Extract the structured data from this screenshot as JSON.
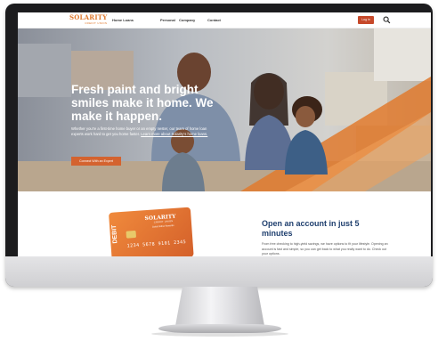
{
  "nav": {
    "logo_main": "SOLARITY",
    "logo_sub": "CREDIT UNION",
    "links": [
      "Home Loans",
      "Personal",
      "Company",
      "Contact"
    ],
    "login_label": "Log in"
  },
  "hero": {
    "title": "Fresh paint and bright smiles make it home. We make it happen.",
    "text": "Whether you're a first-time home buyer or an empty nester, our team of home loan experts work hard to get you home faster.",
    "link_text": "Learn more about Solarity's home loans.",
    "cta_label": "Connect With an Expert"
  },
  "card": {
    "logo": "SOLARITY",
    "sub": "CREDIT UNION",
    "type": "Debit Online Rewards",
    "edge_text": "DEBIT",
    "number": "1234 5678 9101 2345"
  },
  "account": {
    "title": "Open an account in just 5 minutes",
    "text": "From free checking to high-yield savings, we have options to fit your lifestyle. Opening an account is fast and simple, so you can get back to what you really want to do. Check out your options."
  },
  "colors": {
    "brand_orange": "#e07a2e",
    "login_red": "#c6492a",
    "cta_orange": "#d4632f",
    "heading_navy": "#1f3f6e"
  },
  "icons": {
    "search": "search-icon"
  }
}
